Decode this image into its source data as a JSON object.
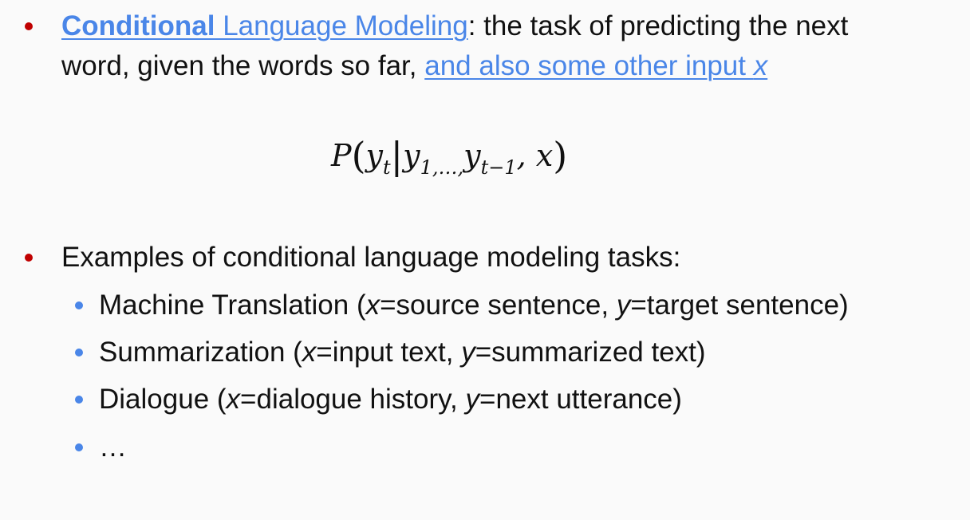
{
  "bullet1": {
    "term_bold": "Conditional",
    "term_rest": " Language Modeling",
    "after_term": ": the task of predicting the next",
    "line2_plain": "word, given the words so far, ",
    "line2_link": "and also some other input ",
    "line2_link_var": "x"
  },
  "formula": {
    "P": "P",
    "lparen": "(",
    "y1": "y",
    "y1_sub": "t",
    "bar": "|",
    "y2": "y",
    "y2_sub": "1,…,",
    "y3": "y",
    "y3_sub": "t−1",
    "comma_x": ", x",
    "rparen": ")"
  },
  "bullet2": {
    "text": "Examples of conditional language modeling tasks:"
  },
  "sub_items": [
    {
      "pre": "Machine Translation (",
      "v1": "x",
      "mid": "=source sentence, ",
      "v2": "y",
      "post": "=target sentence)"
    },
    {
      "pre": "Summarization (",
      "v1": "x",
      "mid": "=input text, ",
      "v2": "y",
      "post": "=summarized text)"
    },
    {
      "pre": "Dialogue (",
      "v1": "x",
      "mid": "=dialogue history, ",
      "v2": "y",
      "post": "=next utterance)"
    },
    {
      "pre": "…",
      "v1": "",
      "mid": "",
      "v2": "",
      "post": ""
    }
  ],
  "colors": {
    "bullet_red": "#c00000",
    "bullet_blue": "#4a86e8",
    "link_blue": "#4a86e8",
    "background": "#fafafa"
  }
}
